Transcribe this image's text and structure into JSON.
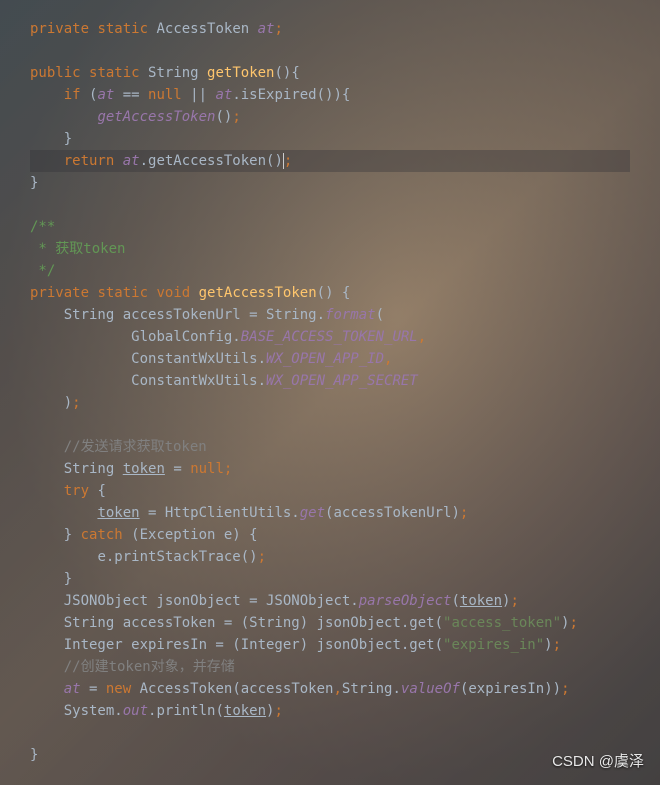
{
  "code": {
    "line1_private": "private",
    "line1_static": "static",
    "line1_type": "AccessToken",
    "line1_var": "at",
    "line3_public": "public",
    "line3_static": "static",
    "line3_type": "String",
    "line3_method": "getToken",
    "line4_if": "if",
    "line4_at": "at",
    "line4_eq": " == ",
    "line4_null": "null",
    "line4_or": " || ",
    "line4_at2": "at",
    "line4_expired": ".isExpired()){",
    "line5_call": "getAccessToken",
    "line7_return": "return",
    "line7_at": "at",
    "line7_get": ".getAccessToken()",
    "comment_block1": "/**",
    "comment_block2": " * 获取token",
    "comment_block3": " */",
    "line11_private": "private",
    "line11_static": "static",
    "line11_void": "void",
    "line11_method": "getAccessToken",
    "line12_str": "String accessTokenUrl = String.",
    "line12_format": "format",
    "line13_gc": "GlobalConfig.",
    "line13_const": "BASE_ACCESS_TOKEN_URL",
    "line14_cw": "ConstantWxUtils.",
    "line14_const": "WX_OPEN_APP_ID",
    "line15_cw": "ConstantWxUtils.",
    "line15_const": "WX_OPEN_APP_SECRET",
    "comment_send": "//发送请求获取token",
    "line18_str": "String ",
    "line18_token": "token",
    "line18_eq": " = ",
    "line18_null": "null",
    "line19_try": "try",
    "line20_token": "token",
    "line20_http": " = HttpClientUtils.",
    "line20_get": "get",
    "line20_args": "(accessTokenUrl)",
    "line21_catch": "catch",
    "line21_ex": " (Exception e) {",
    "line22_print": "e.printStackTrace()",
    "line24_json": "JSONObject jsonObject = JSONObject.",
    "line24_parse": "parseObject",
    "line24_token": "token",
    "line25_str": "String accessToken = (String) jsonObject.get(",
    "line25_lit": "\"access_token\"",
    "line26_int": "Integer expiresIn = (Integer) jsonObject.get(",
    "line26_lit": "\"expires_in\"",
    "comment_create": "//创建token对象，并存储",
    "line28_at": "at",
    "line28_new": "new",
    "line28_rest": " AccessToken(accessToken",
    "line28_str": "String.",
    "line28_valueof": "valueOf",
    "line28_end": "(expiresIn))",
    "line29_sys": "System.",
    "line29_out": "out",
    "line29_print": ".println(",
    "line29_token": "token"
  },
  "watermark": "CSDN @虞泽"
}
